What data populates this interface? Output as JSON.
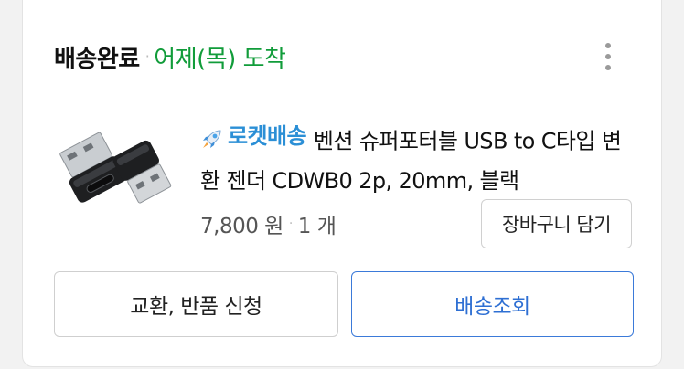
{
  "order": {
    "status": "배송완료",
    "separator": "·",
    "arrival": "어제(목) 도착",
    "more_icon": "more-vertical-icon"
  },
  "product": {
    "badge_icon": "rocket-icon",
    "badge_label": "로켓배송",
    "title": "벤션 슈퍼포터블 USB to C타입 변환 젠더 CDWB0 2p, 20mm, 블랙",
    "price": "7,800 원",
    "separator": "·",
    "quantity": "1 개",
    "cart_button": "장바구니 담기"
  },
  "actions": {
    "exchange_return": "교환, 반품 신청",
    "track_delivery": "배송조회"
  },
  "colors": {
    "arrival": "#119c3a",
    "rocket": "#2b8fd6",
    "track_button": "#2e6fd3"
  }
}
